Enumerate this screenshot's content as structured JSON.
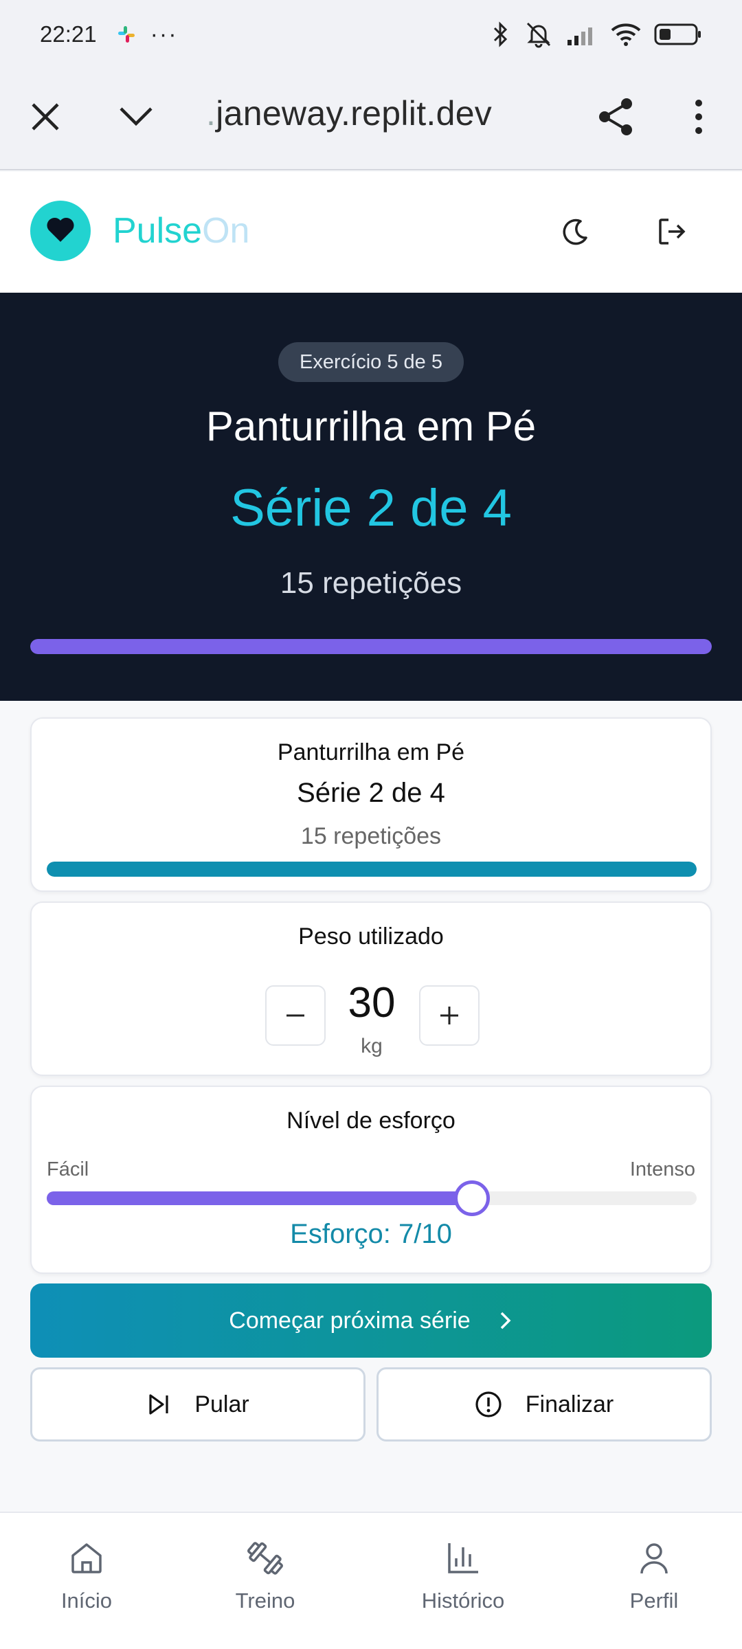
{
  "status_bar": {
    "time": "22:21",
    "dots": "···",
    "icons": [
      "slack-icon",
      "bluetooth-icon",
      "mute-icon",
      "signal-icon",
      "wifi-icon",
      "battery-icon"
    ]
  },
  "browser": {
    "url_prefix": ".",
    "url": "janeway.replit.dev",
    "icons": [
      "close-icon",
      "chevron-down-icon",
      "share-icon",
      "more-vert-icon"
    ]
  },
  "header": {
    "brand_part1": "Pulse",
    "brand_part2": "On",
    "icons": [
      "heart-icon",
      "moon-icon",
      "logout-icon"
    ]
  },
  "hero": {
    "badge": "Exercício 5 de 5",
    "exercise_name": "Panturrilha em Pé",
    "series": "Série 2 de 4",
    "reps": "15 repetições",
    "progress": 1.0
  },
  "set_card": {
    "exercise_name": "Panturrilha em Pé",
    "series": "Série 2 de 4",
    "reps": "15 repetições",
    "progress": 1.0
  },
  "weight_card": {
    "title": "Peso utilizado",
    "value": "30",
    "unit": "kg",
    "minus_label": "−",
    "plus_label": "+"
  },
  "effort_card": {
    "title": "Nível de esforço",
    "min_label": "Fácil",
    "max_label": "Intenso",
    "value": 7,
    "max": 10,
    "readout": "Esforço: 7/10"
  },
  "actions": {
    "next_label": "Começar próxima série",
    "skip_label": "Pular",
    "finish_label": "Finalizar"
  },
  "bottom_nav": {
    "items": [
      {
        "label": "Início",
        "icon": "home-icon"
      },
      {
        "label": "Treino",
        "icon": "dumbbell-icon"
      },
      {
        "label": "Histórico",
        "icon": "bar-chart-icon"
      },
      {
        "label": "Perfil",
        "icon": "user-icon"
      }
    ]
  },
  "colors": {
    "accent_cyan": "#22d3d0",
    "hero_bg": "#101828",
    "series_cyan": "#22c6e2",
    "progress_purple": "#7b62e9",
    "teal": "#0e8fb0"
  }
}
